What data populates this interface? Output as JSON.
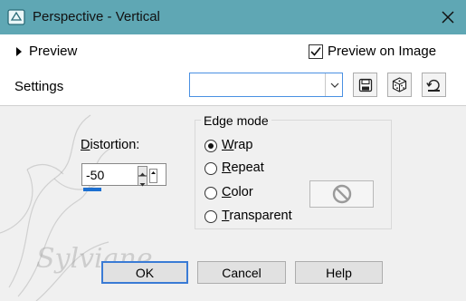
{
  "window": {
    "title": "Perspective - Vertical",
    "titlebar_color": "#5fa7b4"
  },
  "header": {
    "preview_label": "Preview",
    "preview_on_image_label": "Preview on Image",
    "preview_on_image_checked": true,
    "settings_label": "Settings",
    "settings_value": ""
  },
  "icons": [
    "window-icon",
    "close-icon",
    "triangle-right-icon",
    "chevron-down-icon",
    "save-icon",
    "dice-icon",
    "reset-icon",
    "no-entry-icon"
  ],
  "distortion": {
    "label_accel": "D",
    "label_rest": "istortion:",
    "value": "-50"
  },
  "edge_mode": {
    "label": "Edge mode",
    "selected": "Wrap",
    "options": [
      {
        "accel": "W",
        "rest": "rap"
      },
      {
        "accel": "R",
        "rest": "epeat"
      },
      {
        "accel": "C",
        "rest": "olor"
      },
      {
        "accel": "T",
        "rest": "ransparent"
      }
    ]
  },
  "buttons": {
    "ok": "OK",
    "cancel": "Cancel",
    "help": "Help"
  },
  "watermark": "Sylviane",
  "accent_color": "#1c6fd1"
}
